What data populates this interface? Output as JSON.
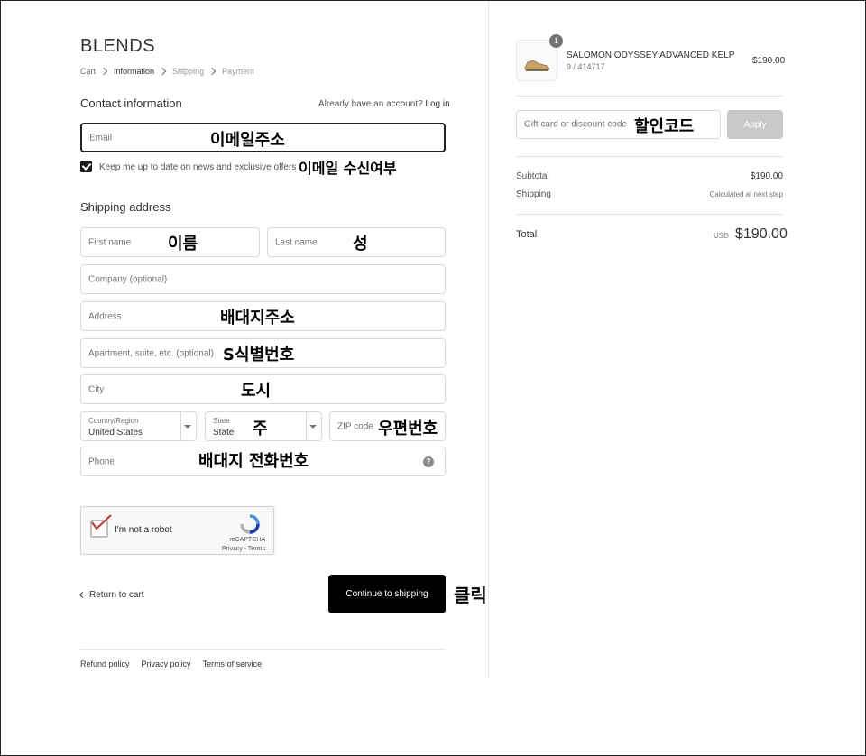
{
  "brand": "BLENDS",
  "breadcrumb": {
    "cart": "Cart",
    "information": "Information",
    "shipping": "Shipping",
    "payment": "Payment"
  },
  "contact": {
    "heading": "Contact information",
    "account_prompt": "Already have an account?",
    "login_link": "Log in",
    "email_placeholder": "Email",
    "newsletter_label": "Keep me up to date on news and exclusive offers",
    "newsletter_checked": true
  },
  "shipping": {
    "heading": "Shipping address",
    "first_name": "First name",
    "last_name": "Last name",
    "company": "Company (optional)",
    "address": "Address",
    "apartment": "Apartment, suite, etc. (optional)",
    "city": "City",
    "country_label": "Country/Region",
    "country_value": "United States",
    "state_label": "State",
    "state_value": "State",
    "zip": "ZIP code",
    "phone": "Phone",
    "phone_help": "?"
  },
  "captcha": {
    "label": "I'm not a robot",
    "brand": "reCAPTCHA",
    "terms": "Privacy - Terms"
  },
  "actions": {
    "return": "Return to cart",
    "continue": "Continue to shipping"
  },
  "footer": {
    "refund": "Refund policy",
    "privacy": "Privacy policy",
    "terms": "Terms of service"
  },
  "order": {
    "product_name": "SALOMON ODYSSEY ADVANCED KELP",
    "product_variant": "9 / 414717",
    "product_price": "$190.00",
    "quantity": "1",
    "discount_placeholder": "Gift card or discount code",
    "apply": "Apply",
    "subtotal_label": "Subtotal",
    "subtotal_value": "$190.00",
    "shipping_label": "Shipping",
    "shipping_value": "Calculated at next step",
    "total_label": "Total",
    "total_currency": "USD",
    "total_value": "$190.00"
  },
  "annotations": {
    "email": "이메일주소",
    "newsletter": "이메일 수신여부",
    "first_name": "이름",
    "last_name": "성",
    "address": "배대지주소",
    "apartment": "S식별번호",
    "city": "도시",
    "state": "주",
    "zip": "우편번호",
    "phone": "배대지 전화번호",
    "discount": "할인코드",
    "continue": "클릭"
  },
  "colors": {
    "primary_button": "#000000",
    "apply_disabled": "#c8c8c8",
    "checkmark_red": "#c0392b"
  }
}
